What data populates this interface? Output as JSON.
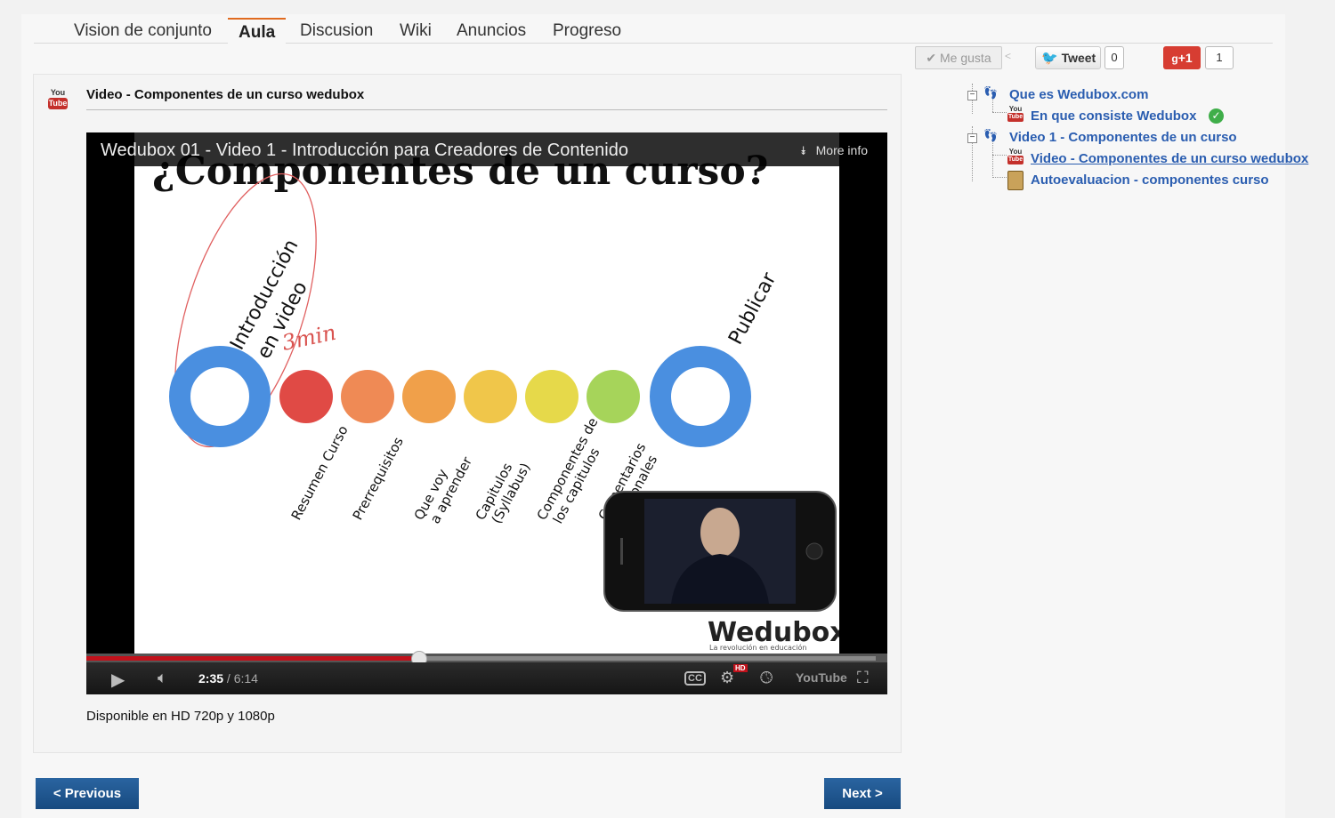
{
  "nav": {
    "tabs": [
      {
        "label": "Vision de conjunto"
      },
      {
        "label": "Aula"
      },
      {
        "label": "Discusion"
      },
      {
        "label": "Wiki"
      },
      {
        "label": "Anuncios"
      },
      {
        "label": "Progreso"
      }
    ],
    "active": "Aula"
  },
  "social": {
    "like_label": "Me gusta",
    "tweet_label": "Tweet",
    "tweet_count": "0",
    "gplus_label": "+1",
    "gplus_count": "1"
  },
  "unit": {
    "title": "Video - Componentes de un curso wedubox",
    "caption": "Disponible en HD 720p y 1080p"
  },
  "video": {
    "title": "Wedubox 01 - Video 1 - Introducción para Creadores de Contenido",
    "more_info": "More info",
    "current_time": "2:35",
    "duration": "6:14",
    "progress_fraction": 0.414,
    "buffered_fraction": 0.985,
    "slide": {
      "heading": "¿Componentes de un curso?",
      "start_label_1": "Introducción",
      "start_label_2": "en video",
      "handwritten": "3min",
      "end_label": "Publicar",
      "steps": [
        {
          "label": "Resumen Curso",
          "color": "#e04a45"
        },
        {
          "label": "Prerrequisitos",
          "color": "#ef8a55"
        },
        {
          "label": "Que voy a aprender",
          "color": "#f0a04a"
        },
        {
          "label": "Capitulos (Syllabus)",
          "color": "#f0c64a"
        },
        {
          "label": "Componentes de los capitulos",
          "color": "#e6d94a"
        },
        {
          "label": "Comentarios adicionales",
          "color": "#a6d45a"
        }
      ],
      "brand": "Wedubox",
      "tagline": "La revolución en educación"
    },
    "controls": {
      "cc": "CC",
      "hd": "HD",
      "youtube": "YouTube"
    }
  },
  "buttons": {
    "previous": "< Previous",
    "next": "Next >"
  },
  "tree": {
    "sections": [
      {
        "title": "Que es Wedubox.com",
        "items": [
          {
            "title": "En que consiste Wedubox",
            "type": "video",
            "done": true
          }
        ]
      },
      {
        "title": "Video 1 - Componentes de un curso",
        "items": [
          {
            "title": "Video - Componentes de un curso wedubox",
            "type": "video",
            "current": true
          },
          {
            "title": "Autoevaluacion - componentes curso",
            "type": "quiz"
          }
        ]
      }
    ]
  },
  "colors": {
    "accent": "#e06b1f",
    "link": "#2a5db0",
    "button": "#1e5799",
    "progress": "#c1111b"
  }
}
